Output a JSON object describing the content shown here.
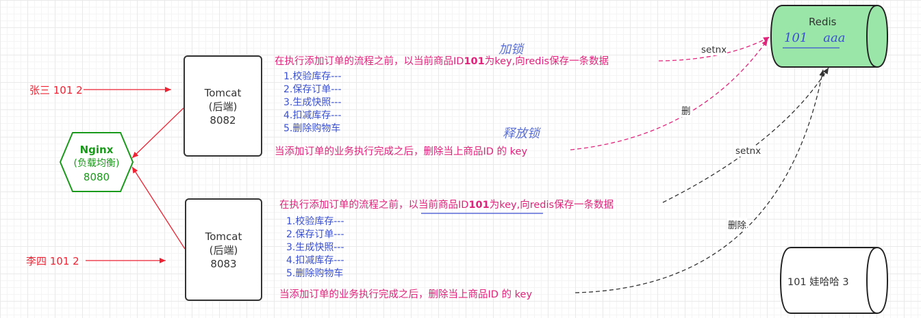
{
  "nginx": {
    "name": "Nginx",
    "role": "(负载均衡)",
    "port": "8080"
  },
  "tomcat1": {
    "name": "Tomcat",
    "role": "(后端)",
    "port": "8082"
  },
  "tomcat2": {
    "name": "Tomcat",
    "role": "(后端)",
    "port": "8083"
  },
  "user1": "张三 101 2",
  "user2": "李四  101 2",
  "redis": {
    "title": "Redis",
    "entry": "101    aaa"
  },
  "db": {
    "entry": "101  娃哈哈 3"
  },
  "flow1": {
    "before_pre": "在执行添加订单的流程之前，以当前商品ID",
    "before_id": "101",
    "before_post": "为key,向redis保存一条数据",
    "steps": [
      "1.校验库存---",
      "2.保存订单---",
      "3.生成快照---",
      "4.扣减库存---",
      "5.删除购物车"
    ],
    "after": "当添加订单的业务执行完成之后，删除当上商品ID 的 key"
  },
  "flow2": {
    "before_pre": "在执行添加订单的流程之前，以当前商品ID",
    "before_id": "101",
    "before_post": "为key,向redis保存一条数据",
    "steps": [
      "1.校验库存---",
      "2.保存订单---",
      "3.生成快照---",
      "4.扣减库存---",
      "5.删除购物车"
    ],
    "after": "当添加订单的业务执行完成之后，删除当上商品ID 的 key"
  },
  "annotations": {
    "lock": "加锁",
    "unlock": "释放锁"
  },
  "edge_labels": {
    "setnx1": "setnx",
    "del1": "删",
    "setnx2": "setnx",
    "del2": "删除"
  },
  "colors": {
    "nginx": "#1a9a1a",
    "red": "#ee2233",
    "magenta": "#e0237a",
    "blue": "#3a4fd0",
    "redis_fill": "#99e6a8"
  }
}
